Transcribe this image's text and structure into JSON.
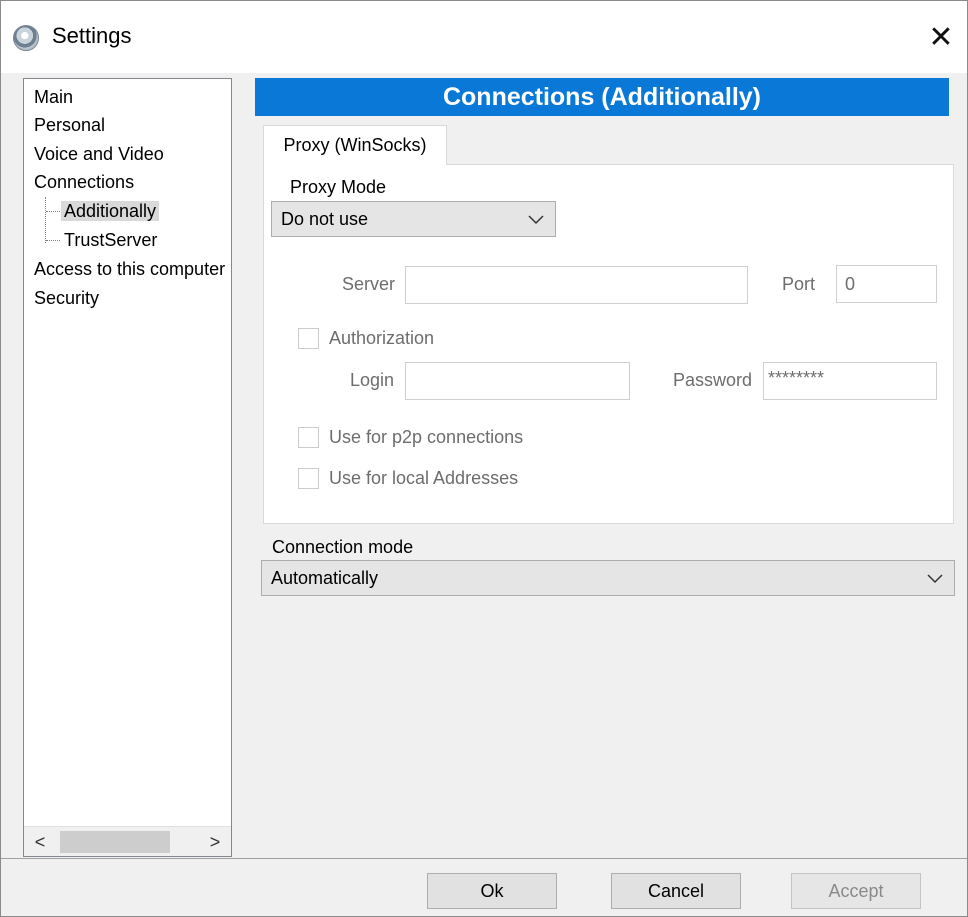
{
  "window": {
    "title": "Settings"
  },
  "tree": {
    "items": [
      {
        "label": "Main"
      },
      {
        "label": "Personal"
      },
      {
        "label": "Voice and Video"
      },
      {
        "label": "Connections"
      },
      {
        "label": "Additionally",
        "selected": true
      },
      {
        "label": "TrustServer"
      },
      {
        "label": "Access to this computer"
      },
      {
        "label": "Security"
      }
    ],
    "scroll_left": "<",
    "scroll_right": ">"
  },
  "header": {
    "title": "Connections (Additionally)",
    "color": "#0a78d7"
  },
  "tab": {
    "label": "Proxy (WinSocks)"
  },
  "proxy": {
    "mode_label": "Proxy Mode",
    "mode_value": "Do not use",
    "server_label": "Server",
    "server_value": "",
    "port_label": "Port",
    "port_value": "0",
    "authorization_label": "Authorization",
    "login_label": "Login",
    "login_value": "",
    "password_label": "Password",
    "password_value": "********",
    "p2p_label": "Use for p2p connections",
    "local_label": "Use for local Addresses"
  },
  "connection": {
    "mode_label": "Connection mode",
    "mode_value": "Automatically"
  },
  "buttons": {
    "ok": "Ok",
    "cancel": "Cancel",
    "accept": "Accept"
  }
}
